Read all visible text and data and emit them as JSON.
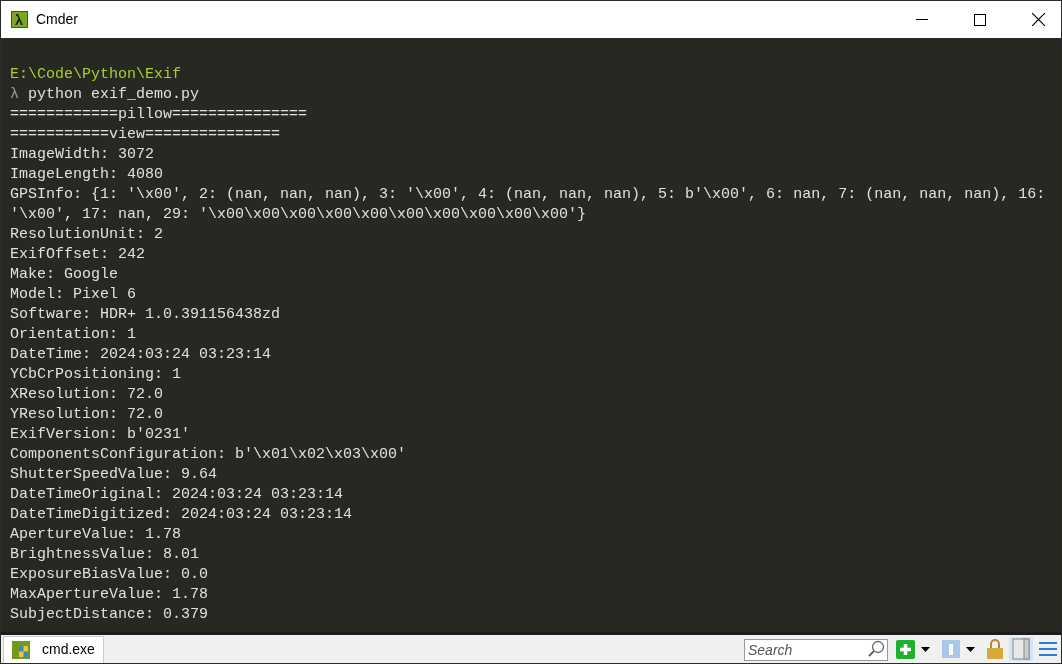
{
  "window": {
    "title": "Cmder"
  },
  "console": {
    "lines": [
      {
        "kind": "path",
        "text": "E:\\Code\\Python\\Exif"
      },
      {
        "kind": "command",
        "prompt": "λ",
        "text": "python exif_demo.py"
      },
      {
        "kind": "output",
        "text": "============pillow==============="
      },
      {
        "kind": "output",
        "text": "===========view==============="
      },
      {
        "kind": "output",
        "text": "ImageWidth: 3072"
      },
      {
        "kind": "output",
        "text": "ImageLength: 4080"
      },
      {
        "kind": "output",
        "text": "GPSInfo: {1: '\\x00', 2: (nan, nan, nan), 3: '\\x00', 4: (nan, nan, nan), 5: b'\\x00', 6: nan, 7: (nan, nan, nan), 16:"
      },
      {
        "kind": "output",
        "text": "'\\x00', 17: nan, 29: '\\x00\\x00\\x00\\x00\\x00\\x00\\x00\\x00\\x00\\x00'}"
      },
      {
        "kind": "output",
        "text": "ResolutionUnit: 2"
      },
      {
        "kind": "output",
        "text": "ExifOffset: 242"
      },
      {
        "kind": "output",
        "text": "Make: Google"
      },
      {
        "kind": "output",
        "text": "Model: Pixel 6"
      },
      {
        "kind": "output",
        "text": "Software: HDR+ 1.0.391156438zd"
      },
      {
        "kind": "output",
        "text": "Orientation: 1"
      },
      {
        "kind": "output",
        "text": "DateTime: 2024:03:24 03:23:14"
      },
      {
        "kind": "output",
        "text": "YCbCrPositioning: 1"
      },
      {
        "kind": "output",
        "text": "XResolution: 72.0"
      },
      {
        "kind": "output",
        "text": "YResolution: 72.0"
      },
      {
        "kind": "output",
        "text": "ExifVersion: b'0231'"
      },
      {
        "kind": "output",
        "text": "ComponentsConfiguration: b'\\x01\\x02\\x03\\x00'"
      },
      {
        "kind": "output",
        "text": "ShutterSpeedValue: 9.64"
      },
      {
        "kind": "output",
        "text": "DateTimeOriginal: 2024:03:24 03:23:14"
      },
      {
        "kind": "output",
        "text": "DateTimeDigitized: 2024:03:24 03:23:14"
      },
      {
        "kind": "output",
        "text": "ApertureValue: 1.78"
      },
      {
        "kind": "output",
        "text": "BrightnessValue: 8.01"
      },
      {
        "kind": "output",
        "text": "ExposureBiasValue: 0.0"
      },
      {
        "kind": "output",
        "text": "MaxApertureValue: 1.78"
      },
      {
        "kind": "output",
        "text": "SubjectDistance: 0.379"
      }
    ]
  },
  "status_bar": {
    "tabs": [
      {
        "label": "cmd.exe",
        "selected": true
      }
    ],
    "search": {
      "placeholder": "Search"
    }
  }
}
